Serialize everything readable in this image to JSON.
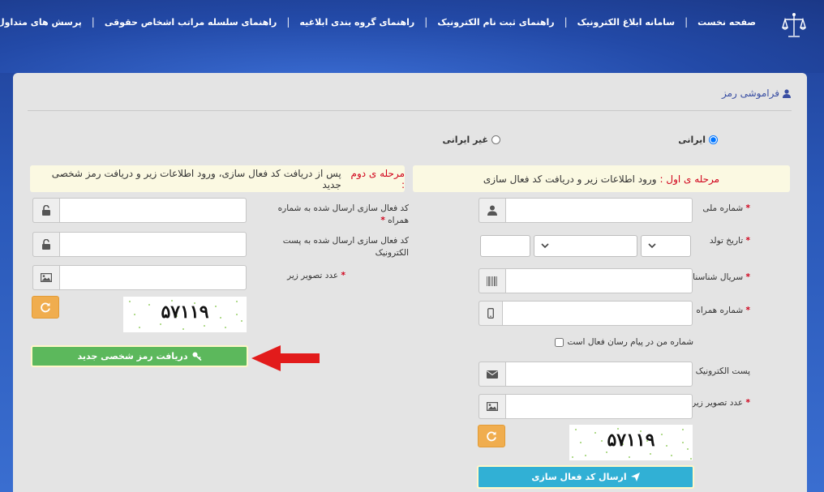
{
  "nav": {
    "home": "صفحه نخست",
    "ablagh_system": "سامانه ابلاغ الکترونیک",
    "register_guide": "راهنمای ثبت نام الکترونیک",
    "grouping_guide": "راهنمای گروه بندی ابلاغیه",
    "legal_hierarchy_guide": "راهنمای سلسله مراتب اشخاص حقوقی",
    "faq": "پرسش های متداول"
  },
  "panel": {
    "title": "فراموشی رمز"
  },
  "nationality": {
    "iranian": "ایرانی",
    "non_iranian": "غیر ایرانی"
  },
  "stage1": {
    "prefix": "مرحله ی اول :",
    "text": "ورود اطلاعات زیر و دریافت کد فعال سازی"
  },
  "stage2": {
    "prefix": "مرحله ی دوم :",
    "text": "پس از دریافت کد فعال سازی، ورود اطلاعات زیر و دریافت رمز شخصی جدید"
  },
  "form1": {
    "national_code": "شماره ملی",
    "birth_date": "تاریخ تولد",
    "id_serial": "سریال شناسنامه",
    "mobile": "شماره همراه",
    "messenger_check": "شماره من در پیام رسان فعال است",
    "email": "پست الکترونیک",
    "captcha_label": "عدد تصویر زیر",
    "captcha_value": "۵۷۱۱۹",
    "submit": "ارسال کد فعال سازی"
  },
  "form2": {
    "sms_code": "کد فعال سازی ارسال شده به شماره همراه",
    "email_code": "کد فعال سازی ارسال شده به پست الکترونیک",
    "captcha_label": "عدد تصویر زیر",
    "captcha_value": "۵۷۱۱۹",
    "submit": "دریافت رمز شخصی جدید"
  },
  "required_mark": "*",
  "colors": {
    "accent_red": "#d0021b",
    "green_button": "#5cb85c",
    "blue_button": "#31b0d5",
    "orange_button": "#f0ad4e"
  }
}
